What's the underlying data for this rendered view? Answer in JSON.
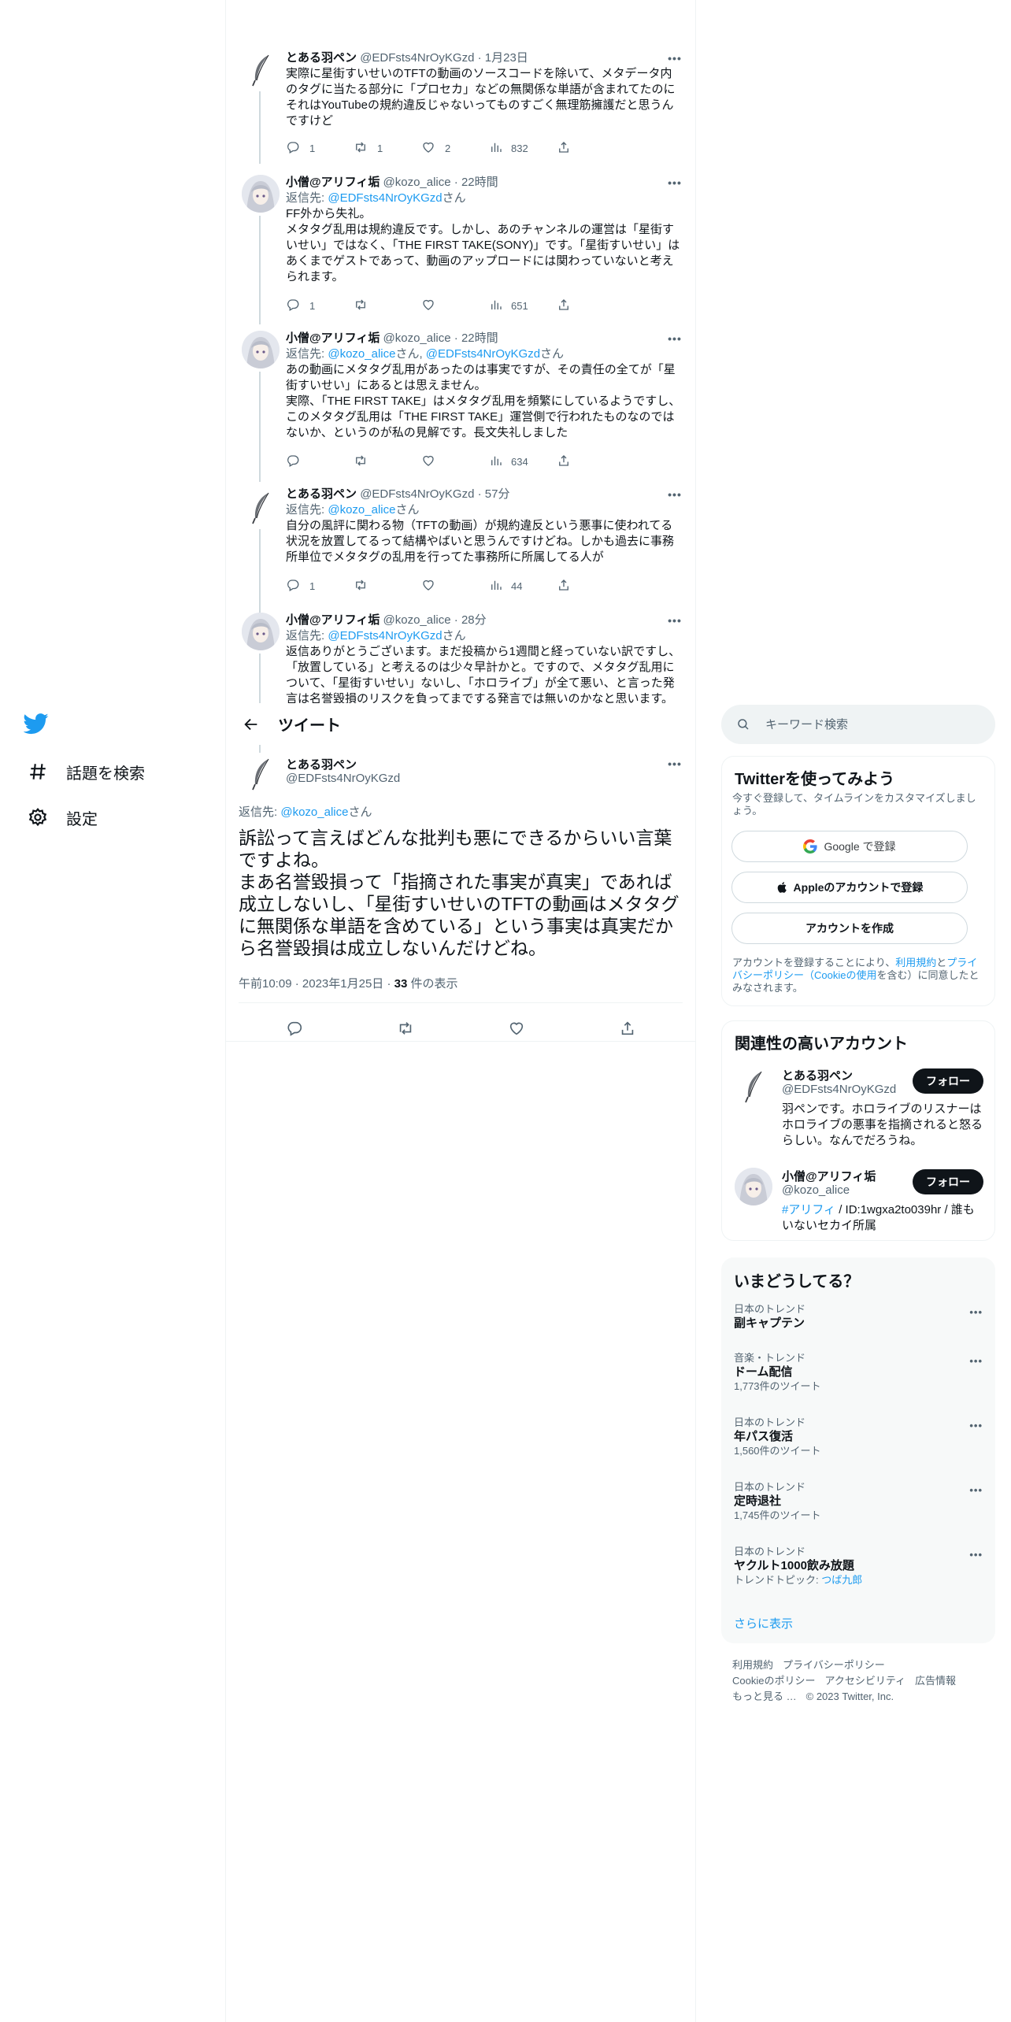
{
  "nav": {
    "explore": "話題を検索",
    "settings": "設定"
  },
  "thread": [
    {
      "name": "とある羽ペン",
      "handle": "@EDFsts4NrOyKGzd",
      "time": "1月23日",
      "reply_prefix": "",
      "reply_mentions": [],
      "reply_suffix": "",
      "text": "実際に星街すいせいのTFTの動画のソースコードを除いて、メタデータ内のタグに当たる部分に「プロセカ」などの無関係な単語が含まれてたのにそれはYouTubeの規約違反じゃないってものすごく無理筋擁護だと思うんですけど",
      "replies": "1",
      "retweets": "1",
      "likes": "2",
      "views": "832"
    },
    {
      "name": "小僧@アリフィ垢",
      "handle": "@kozo_alice",
      "time": "22時間",
      "reply_prefix": "返信先: ",
      "reply_mentions": [
        "@EDFsts4NrOyKGzd"
      ],
      "reply_suffix": "さん",
      "text": "FF外から失礼。\nメタタグ乱用は規約違反です。しかし、あのチャンネルの運営は「星街すいせい」ではなく、「THE FIRST TAKE(SONY)」です。「星街すいせい」はあくまでゲストであって、動画のアップロードには関わっていないと考えられます。",
      "replies": "1",
      "retweets": "",
      "likes": "",
      "views": "651"
    },
    {
      "name": "小僧@アリフィ垢",
      "handle": "@kozo_alice",
      "time": "22時間",
      "reply_prefix": "返信先: ",
      "reply_mentions": [
        "@kozo_alice",
        "@EDFsts4NrOyKGzd"
      ],
      "reply_suffix": "さん",
      "text": "あの動画にメタタグ乱用があったのは事実ですが、その責任の全てが「星街すいせい」にあるとは思えません。\n実際、「THE FIRST TAKE」はメタタグ乱用を頻繁にしているようですし、このメタタグ乱用は「THE FIRST TAKE」運営側で行われたものなのではないか、というのが私の見解です。長文失礼しました",
      "replies": "",
      "retweets": "",
      "likes": "",
      "views": "634"
    },
    {
      "name": "とある羽ペン",
      "handle": "@EDFsts4NrOyKGzd",
      "time": "57分",
      "reply_prefix": "返信先: ",
      "reply_mentions": [
        "@kozo_alice"
      ],
      "reply_suffix": "さん",
      "text": "自分の風評に関わる物（TFTの動画）が規約違反という悪事に使われてる状況を放置してるって結構やばいと思うんですけどね。しかも過去に事務所単位でメタタグの乱用を行ってた事務所に所属してる人が",
      "replies": "1",
      "retweets": "",
      "likes": "",
      "views": "44"
    },
    {
      "name": "小僧@アリフィ垢",
      "handle": "@kozo_alice",
      "time": "28分",
      "reply_prefix": "返信先: ",
      "reply_mentions": [
        "@EDFsts4NrOyKGzd"
      ],
      "reply_suffix": "さん",
      "text": "返信ありがとうございます。まだ投稿から1週間と経っていない訳ですし、「放置している」と考えるのは少々早計かと。ですので、メタタグ乱用について、「星街すいせい」ないし、「ホロライブ」が全て悪い、と言った発言は名誉毀損のリスクを負ってまでする発言では無いのかなと思います。",
      "replies": "",
      "retweets": "",
      "likes": "",
      "views": ""
    }
  ],
  "header": {
    "title": "ツイート"
  },
  "focus": {
    "name": "とある羽ペン",
    "handle": "@EDFsts4NrOyKGzd",
    "reply_prefix": "返信先: ",
    "reply_mention": "@kozo_alice",
    "reply_suffix": "さん",
    "text": "訴訟って言えばどんな批判も悪にできるからいい言葉ですよね。\nまあ名誉毀損って「指摘された事実が真実」であれば成立しないし、「星街すいせいのTFTの動画はメタタグに無関係な単語を含めている」という事実は真実だから名誉毀損は成立しないんだけどね。",
    "time": "午前10:09",
    "date": "2023年1月25日",
    "views_count": "33",
    "views_label": " 件の表示"
  },
  "search": {
    "placeholder": "キーワード検索"
  },
  "signup": {
    "title": "Twitterを使ってみよう",
    "subtitle": "今すぐ登録して、タイムラインをカスタマイズしましょう。",
    "google": "Google で登録",
    "apple": "Appleのアカウントで登録",
    "create": "アカウントを作成",
    "legal_1": "アカウントを登録することにより、",
    "legal_terms": "利用規約",
    "legal_2": "と",
    "legal_privacy": "プライバシーポリシー（Cookieの使用",
    "legal_3": "を含む）に同意したとみなされます。"
  },
  "related": {
    "title": "関連性の高いアカウント",
    "follow": "フォロー",
    "users": [
      {
        "name": "とある羽ペン",
        "handle": "@EDFsts4NrOyKGzd",
        "bio_link": "",
        "bio": "羽ペンです。ホロライブのリスナーはホロライブの悪事を指摘されると怒るらしい。なんでだろうね。"
      },
      {
        "name": "小僧@アリフィ垢",
        "handle": "@kozo_alice",
        "bio_link": "#アリフィ",
        "bio": " / ID:1wgxa2to039hr / 誰もいないセカイ所属"
      }
    ]
  },
  "trends": {
    "title": "いまどうしてる？",
    "items": [
      {
        "context": "日本のトレンド",
        "name": "副キャプテン",
        "count": "",
        "topic_label": "",
        "topic": ""
      },
      {
        "context": "音楽・トレンド",
        "name": "ドーム配信",
        "count": "1,773件のツイート",
        "topic_label": "",
        "topic": ""
      },
      {
        "context": "日本のトレンド",
        "name": "年パス復活",
        "count": "1,560件のツイート",
        "topic_label": "",
        "topic": ""
      },
      {
        "context": "日本のトレンド",
        "name": "定時退社",
        "count": "1,745件のツイート",
        "topic_label": "",
        "topic": ""
      },
      {
        "context": "日本のトレンド",
        "name": "ヤクルト1000飲み放題",
        "count": "",
        "topic_label": "トレンドトピック: ",
        "topic": "つば九郎"
      }
    ],
    "show_more": "さらに表示"
  },
  "footer": {
    "row1": [
      "利用規約",
      "プライバシーポリシー"
    ],
    "row2": [
      "Cookieのポリシー",
      "アクセシビリティ",
      "広告情報"
    ],
    "row3": [
      "もっと見る …",
      "© 2023 Twitter, Inc."
    ]
  },
  "colors": {
    "accent": "#1d9bf0",
    "text": "#0f1419",
    "muted": "#536471",
    "border": "#eff3f4"
  },
  "icons": [
    "twitter-logo-icon",
    "hashtag-icon",
    "gear-icon",
    "reply-icon",
    "retweet-icon",
    "like-icon",
    "views-icon",
    "share-icon",
    "back-arrow-icon",
    "search-icon",
    "google-logo-icon",
    "apple-logo-icon",
    "more-icon"
  ]
}
